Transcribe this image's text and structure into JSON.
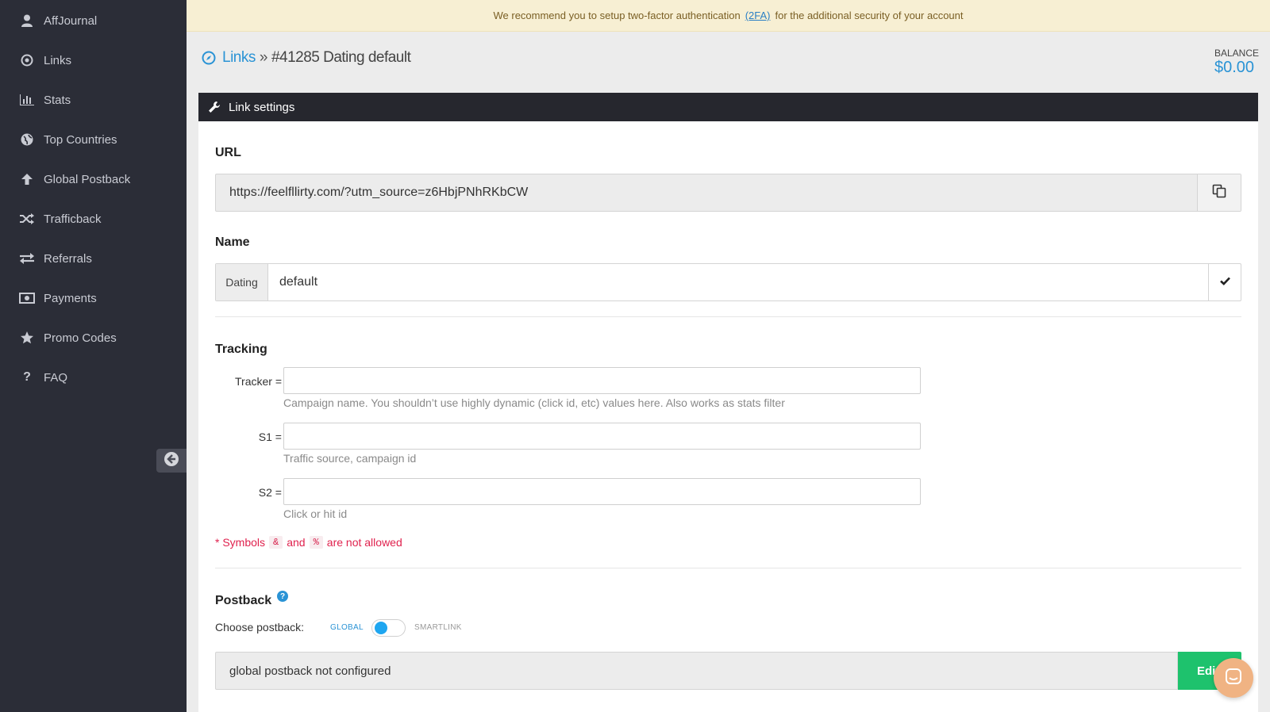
{
  "sidebar": {
    "items": [
      {
        "label": "AffJournal",
        "icon": "user-icon"
      },
      {
        "label": "Links",
        "icon": "compass-icon"
      },
      {
        "label": "Stats",
        "icon": "bar-chart-icon"
      },
      {
        "label": "Top Countries",
        "icon": "globe-icon"
      },
      {
        "label": "Global Postback",
        "icon": "arrow-up-icon"
      },
      {
        "label": "Trafficback",
        "icon": "shuffle-icon"
      },
      {
        "label": "Referrals",
        "icon": "exchange-icon"
      },
      {
        "label": "Payments",
        "icon": "money-icon"
      },
      {
        "label": "Promo Codes",
        "icon": "star-icon"
      },
      {
        "label": "FAQ",
        "icon": "question-icon"
      }
    ]
  },
  "banner": {
    "before": "We recommend you to setup two-factor authentication",
    "link": "(2FA)",
    "after": "for the additional security of your account"
  },
  "breadcrumb": {
    "link": "Links",
    "separator": "»",
    "current": "#41285 Dating default"
  },
  "balance": {
    "label": "BALANCE",
    "value": "$0.00"
  },
  "panel": {
    "title": "Link settings"
  },
  "url": {
    "title": "URL",
    "value": "https://feelfllirty.com/?utm_source=z6HbjPNhRKbCW"
  },
  "name": {
    "title": "Name",
    "prefix": "Dating",
    "value": "default"
  },
  "tracking": {
    "title": "Tracking",
    "fields": [
      {
        "label": "Tracker =",
        "value": "",
        "help": "Campaign name. You shouldn’t use highly dynamic (click id, etc) values here. Also works as stats filter"
      },
      {
        "label": "S1 =",
        "value": "",
        "help": "Traffic source, campaign id"
      },
      {
        "label": "S2 =",
        "value": "",
        "help": "Click or hit id"
      }
    ],
    "warning": {
      "prefix": "* Symbols",
      "sym1": "&",
      "middle": "and",
      "sym2": "%",
      "suffix": "are not allowed"
    }
  },
  "postback": {
    "title": "Postback",
    "help_glyph": "?",
    "choose_label": "Choose postback:",
    "option_global": "GLOBAL",
    "option_smartlink": "SMARTLINK",
    "selected": "GLOBAL",
    "value": "global postback not configured",
    "edit_label": "Edit"
  },
  "colors": {
    "sidebar_bg": "#2b2d37",
    "accent": "#2a93d5",
    "edit_green": "#1ec26d",
    "warning_red": "#e0224e",
    "banner_bg": "#f7efd3"
  }
}
